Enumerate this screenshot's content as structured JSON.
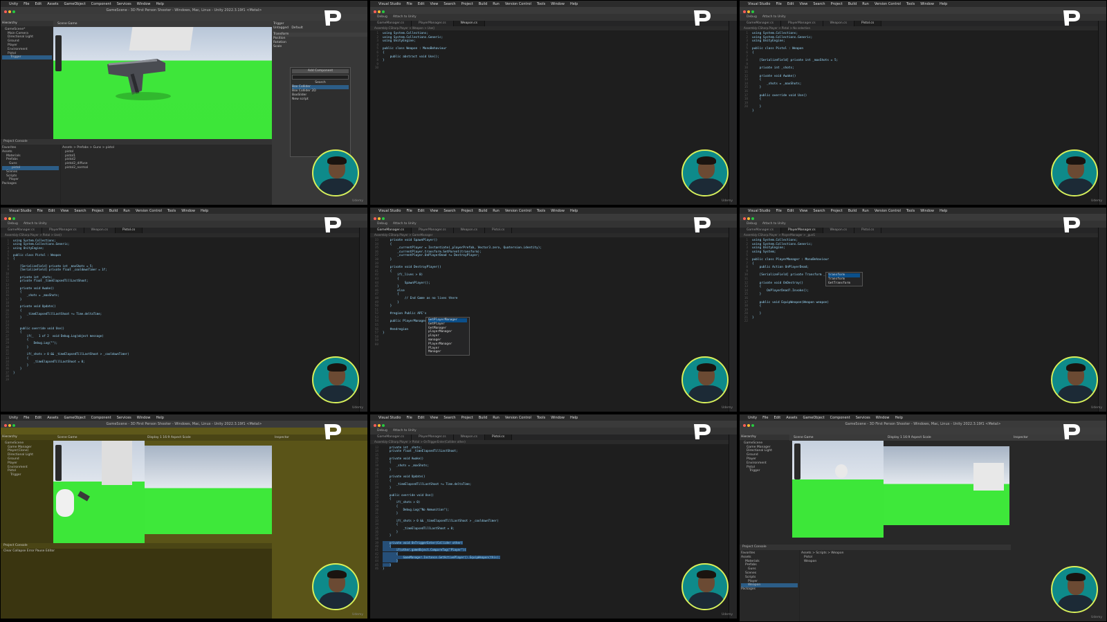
{
  "menus": {
    "unity": [
      "Unity",
      "File",
      "Edit",
      "Assets",
      "GameObject",
      "Component",
      "Services",
      "Window",
      "Help"
    ],
    "vs": [
      "Visual Studio",
      "File",
      "Edit",
      "View",
      "Search",
      "Project",
      "Build",
      "Run",
      "Version Control",
      "Tools",
      "Window",
      "Help"
    ]
  },
  "unity_title": "GameScene - 3D First Person Shooter - Windows, Mac, Linux - Unity 2022.3.19f1 <Metal>",
  "vs_toolbar": {
    "debug": "Debug",
    "attach": "Attach to Unity"
  },
  "watermark": "Udemy",
  "colors": {
    "accent": "#2c5d87",
    "ground": "#3ee63a",
    "avatar_ring": "#d9ef5a",
    "avatar_bg": "#0e8a8a"
  },
  "panel0": {
    "scene_tabs": "Scene   Game",
    "hierarchy_title": "Hierarchy",
    "hierarchy": [
      "GameScene*",
      "Main Camera",
      "Directional Light",
      "Ground",
      "Player",
      "Environment",
      "Pistol",
      "Trigger"
    ],
    "inspector_name": "Trigger",
    "inspector_tag": "Untagged",
    "inspector_layer": "Default",
    "transform_label": "Transform",
    "transform_rows": [
      "Position",
      "Rotation",
      "Scale"
    ],
    "add_component": "Add Component",
    "search_label": "Search",
    "component_items": [
      "Box Collider",
      "Box Collider 2D",
      "BoxSlider",
      "New script"
    ],
    "project_tabs": "Project   Console",
    "project_tree": [
      "Favorites",
      "Assets",
      "Materials",
      "Prefabs",
      "Guns",
      "pistol",
      "Scenes",
      "Scripts",
      "Player",
      "Packages"
    ],
    "project_path": "Assets > Prefabs > Guns > pistol",
    "project_files": [
      "pistol",
      "pistol1",
      "pistol2",
      "pistol2_diffuse",
      "pistol2_normal"
    ]
  },
  "panel1": {
    "tabs": [
      "GameManager.cs",
      "PlayerManager.cs",
      "Weapon.cs"
    ],
    "crumbs": "Assembly-CSharp.Player  >  Weapon  >  Use()",
    "gutter": "1\n2\n3\n4\n5\n6\n7\n8\n9\n10",
    "code": "using System.Collections;\nusing System.Collections.Generic;\nusing UnityEngine;\n\npublic class Weapon : MonoBehaviour\n{\n    public abstract void Use();\n}\n"
  },
  "panel2": {
    "tabs": [
      "GameManager.cs",
      "PlayerManager.cs",
      "Weapon.cs",
      "Pistol.cs"
    ],
    "crumbs": "Assembly-CSharp.Player  >  Pistol  >  No selection",
    "gutter": "1\n2\n3\n4\n5\n6\n7\n8\n9\n10\n11\n12\n13\n14\n15\n16\n17\n18\n19\n20",
    "code": "using System.Collections;\nusing System.Collections.Generic;\nusing UnityEngine;\n\npublic class Pistol : Weapon\n{\n\n    [SerializeField] private int _maxShots = 5;\n\n    private int _shots;\n\n    private void Awake()\n    {\n        _shots = _maxShots;\n    }\n\n    public override void Use()\n    {\n\n    }\n}"
  },
  "panel3": {
    "tabs": [
      "GameManager.cs",
      "PlayerManager.cs",
      "Weapon.cs",
      "Pistol.cs"
    ],
    "crumbs": "Assembly-CSharp.Player  >  Pistol  >  Use()",
    "gutter": "1\n2\n3\n4\n5\n6\n7\n8\n9\n10\n11\n12\n13\n14\n15\n16\n17\n18\n19\n20\n21\n22\n23\n24\n25\n26\n27\n28\n29\n30\n31\n32\n33\n34\n35\n36\n37\n38\n39",
    "code": "using System.Collections;\nusing System.Collections.Generic;\nusing UnityEngine;\n\npublic class Pistol : Weapon\n{\n\n    [SerializeField] private int _maxShots = 5;\n    [SerializeField] private float _cooldownTimer = 1f;\n\n    private int _shots;\n    private float _timeElapsedTillLastShoot;\n\n    private void Awake()\n    {\n        _shots = _maxShots;\n    }\n\n    private void Update()\n    {\n        _timeElapsedTillLastShoot += Time.deltaTime;\n    }\n\n\n    public override void Use()\n    {\n        if(_   1 of 2  void Debug.Log(object message)\n        {\n            Debug.Log(\"\");\n        }\n\n        if(_shots > 0 && _timeElapsedTillLastShoot > _cooldownTimer)\n        {\n            _timeElapsedTillLastShoot = 0;\n        }\n    }\n}"
  },
  "panel4": {
    "tabs": [
      "GameManager.cs",
      "PlayerManager.cs",
      "Weapon.cs",
      "Pistol.cs"
    ],
    "crumbs": "Assembly-CSharp.Player  >  GameManager",
    "gutter": "33\n34\n35\n36\n37\n38\n39\n40\n41\n42\n43\n44\n45\n46\n47\n48\n49\n50\n51\n52\n53\n54\n55\n56\n57\n58\n59\n60",
    "code": "    private void SpawnPlayer()\n    {\n        _currentPlayer = Instantiate(_playerPrefab, Vector3.zero, Quaternion.identity);\n        _currentPlayer.transform.SetParent(transform);\n        _currentPlayer.OnPlayerDead += DestroyPlayer;\n    }\n\n    private void DestroyPlayer()\n    {\n        if(_lives > 0)\n        {\n            SpawnPlayer();\n        }\n        else\n        {\n            // End Game as no lives there\n        }\n    }\n\n    #region Public API's\n\n    public PlayerManager G|\n\n    #endregion\n}\n",
    "autocomplete": [
      "GetPlayerManager",
      "GetPlayer",
      "GetManager",
      "playerManager",
      "player",
      "manager",
      "PlayerManager",
      "Player",
      "Manager"
    ]
  },
  "panel5": {
    "tabs": [
      "GameManager.cs",
      "PlayerManager.cs",
      "Weapon.cs",
      "Pistol.cs"
    ],
    "crumbs": "Assembly-CSharp.Player  >  PlayerManager  >  _gunS",
    "gutter": "1\n2\n3\n4\n5\n6\n7\n8\n9\n10\n11\n12\n13\n14\n15\n16\n17\n18\n19\n20\n21\n22",
    "code": "using System.Collections;\nusing System.Collections.Generic;\nusing UnityEngine;\nusing System;\n\npublic class PlayerManager : MonoBehaviour\n{\n    public Action OnPlayerDead;\n\n    [SerializeField] private Transform _gunS\n\n    private void OnDestroy()\n    {\n        OnPlayerDead?.Invoke();\n    }\n\n    public void EquipWeapon(Weapon weapon)\n    {\n\n    }\n}\n",
    "autocomplete": [
      "transform",
      "Transform",
      "GetTransform"
    ]
  },
  "panel6": {
    "scene_tabs": "Scene   Game",
    "game_display": "Display 1   16:9 Aspect   Scale",
    "inspector_title": "Inspector",
    "hierarchy_title": "Hierarchy",
    "hierarchy": [
      "GameScene",
      "Game Manager",
      "Player(Clone)",
      "Directional Light",
      "Ground",
      "Player",
      "Environment",
      "Pistol",
      "Trigger"
    ],
    "project_tabs": "Project   Console",
    "console_bar": "Clear   Collapse   Error Pause   Editor"
  },
  "panel7": {
    "tabs": [
      "GameManager.cs",
      "PlayerManager.cs",
      "Weapon.cs",
      "Pistol.cs"
    ],
    "crumbs": "Assembly-CSharp.Player  >  Pistol  >  OnTriggerEnter(Collider other)",
    "gutter": "13\n14\n15\n16\n17\n18\n19\n20\n21\n22\n23\n24\n25\n26\n27\n28\n29\n30\n31\n32\n33\n34\n35\n36\n37\n38\n39\n40\n41\n42\n43\n44\n45\n46",
    "code_top": "    private int _shots;\n    private float _timeElapsedTillLastShoot;\n\n    private void Awake()\n    {\n        _shots = _maxShots;\n    }\n\n    private void Update()\n    {\n        _timeElapsedTillLastShoot += Time.deltaTime;\n    }\n\n    public override void Use()\n    {\n        if(_shots > 0)\n        {\n            Debug.Log(\"No Ammunition\");\n        }\n\n        if(_shots > 0 && _timeElapsedTillLastShoot > _cooldownTimer)\n        {\n            _timeElapsedTillLastShoot = 0;\n        }\n    }\n\n",
    "code_sel": "    private void OnTriggerEnter(Collider other)\n    {\n        if(other.gameObject.CompareTag(\"Player\"))\n        {\n            GameManager.Instance.GetActivePlayer().EquipWeapon(this);\n        }\n    }",
    "code_end": "\n}"
  },
  "panel8": {
    "scene_tabs": "Scene   Game",
    "game_display": "Display 1   16:9 Aspect   Scale",
    "hierarchy_title": "Hierarchy",
    "hierarchy": [
      "GameScene",
      "Game Manager",
      "Directional Light",
      "Ground",
      "Player",
      "Environment",
      "Pistol",
      "Trigger"
    ],
    "inspector_title": "Inspector",
    "project_tabs": "Project   Console",
    "project_tree": [
      "Favorites",
      "Assets",
      "Materials",
      "Prefabs",
      "Guns",
      "Scenes",
      "Scripts",
      "Player",
      "Weapon",
      "Packages"
    ],
    "project_path": "Assets > Scripts > Weapon",
    "project_files": [
      "Pistol",
      "Weapon"
    ]
  }
}
